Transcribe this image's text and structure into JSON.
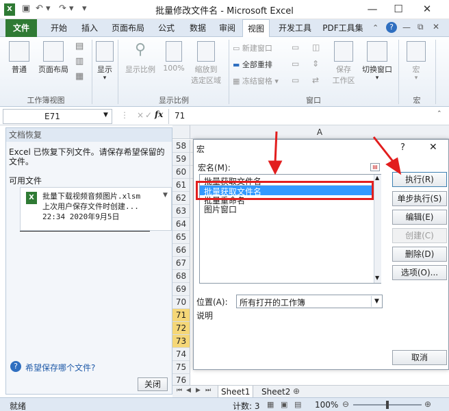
{
  "window": {
    "title": "批量修改文件名 - Microsoft Excel"
  },
  "tabs": [
    "文件",
    "开始",
    "插入",
    "页面布局",
    "公式",
    "数据",
    "审阅",
    "视图",
    "开发工具",
    "PDF工具集"
  ],
  "ribbon": {
    "group1": {
      "label": "工作簿视图",
      "buttons": [
        "普通",
        "页面布局"
      ]
    },
    "display_label": "显示",
    "group2": {
      "label": "显示比例",
      "buttons": [
        "显示比例",
        "100%",
        "缩放到",
        "选定区域"
      ]
    },
    "group3": {
      "label": "窗口",
      "items": [
        "新建窗口",
        "全部重排",
        "冻结窗格",
        "保存",
        "工作区",
        "切换窗口"
      ]
    },
    "group4": {
      "label": "宏",
      "buttons": [
        "宏"
      ]
    }
  },
  "formula_bar": {
    "cell_ref": "E71",
    "fx": "fx",
    "value": "71"
  },
  "recovery": {
    "header": "文档恢复",
    "message": "Excel 已恢复下列文件。请保存希望保留的文件。",
    "available": "可用文件",
    "file": {
      "name": "批量下载视频音频图片.xlsm",
      "info": "上次用户保存文件时创建...",
      "time": "22:34 2020年9月5日"
    },
    "help_link": "希望保存哪个文件?",
    "close_label": "关闭"
  },
  "sheet": {
    "column": "A",
    "rows": [
      "58",
      "59",
      "60",
      "61",
      "62",
      "63",
      "64",
      "65",
      "66",
      "67",
      "68",
      "69",
      "70",
      "71",
      "72",
      "73",
      "74",
      "75",
      "76"
    ],
    "selected_rows": [
      "71",
      "72",
      "73"
    ],
    "tabs": [
      "Sheet1",
      "Sheet2"
    ]
  },
  "dialog": {
    "title": "宏",
    "help": "?",
    "close": "✕",
    "macro_name_label": "宏名(M):",
    "macro_name_value": "批量获取文件名",
    "list": [
      "批量获取文件名",
      "批量重命名",
      "图片窗口"
    ],
    "selected_index": 0,
    "buttons": [
      "执行(R)",
      "单步执行(S)",
      "编辑(E)",
      "创建(C)",
      "删除(D)",
      "选项(O)..."
    ],
    "location_label": "位置(A):",
    "location_value": "所有打开的工作簿",
    "desc_label": "说明",
    "cancel": "取消"
  },
  "statusbar": {
    "ready": "就绪",
    "count": "计数: 3",
    "zoom": "100%"
  },
  "colors": {
    "file_tab": "#2f7a34",
    "selection": "#3399ff",
    "annotation": "#e21e1e"
  }
}
